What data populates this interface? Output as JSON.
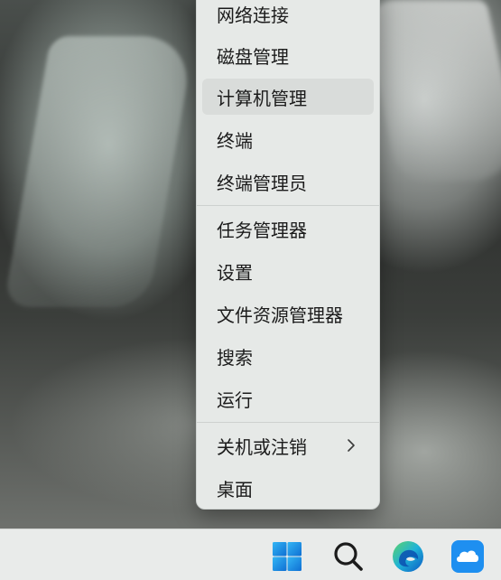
{
  "context_menu": {
    "items": [
      {
        "label": "网络连接"
      },
      {
        "label": "磁盘管理"
      },
      {
        "label": "计算机管理"
      },
      {
        "label": "终端"
      },
      {
        "label": "终端管理员"
      },
      {
        "label": "任务管理器"
      },
      {
        "label": "设置"
      },
      {
        "label": "文件资源管理器"
      },
      {
        "label": "搜索"
      },
      {
        "label": "运行"
      },
      {
        "label": "关机或注销"
      },
      {
        "label": "桌面"
      }
    ],
    "hovered_item": "计算机管理",
    "submenu_item": "关机或注销"
  },
  "taskbar": {
    "icons": [
      "windows-start-icon",
      "search-icon",
      "edge-browser-icon",
      "cloud-app-icon"
    ]
  },
  "colors": {
    "menu_background": "#e6e9e7",
    "hover_background": "#d9dcda",
    "windows_blue": "#1a8fe0",
    "cloud_blue": "#1e8ff0"
  }
}
